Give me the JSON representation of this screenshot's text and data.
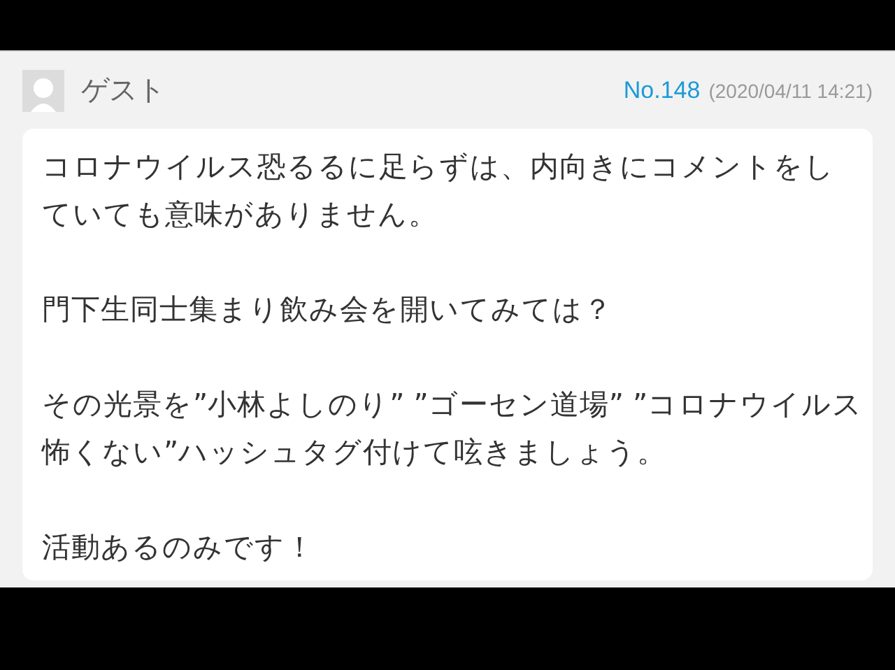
{
  "comment": {
    "author": "ゲスト",
    "number": "No.148",
    "timestamp": "(2020/04/11 14:21)",
    "paragraphs": [
      {
        "lines": [
          "コロナウイルス恐るるに足らずは、内向きにコメントをし",
          "ていても意味がありません。"
        ]
      },
      {
        "lines": [
          "門下生同士集まり飲み会を開いてみては？"
        ]
      },
      {
        "lines": [
          "その光景を”小林よしのり” ”ゴーセン道場” ”コロナウイルス",
          "怖くない”ハッシュタグ付けて呟きましょう。"
        ]
      },
      {
        "lines": [
          "活動あるのみです！"
        ]
      }
    ]
  }
}
